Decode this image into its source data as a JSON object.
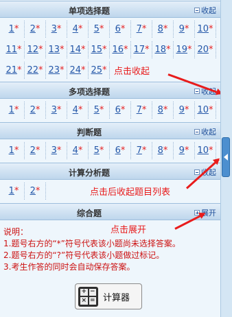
{
  "sections": [
    {
      "title": "单项选择题",
      "toggle": "收起",
      "rows": [
        [
          "1",
          "2",
          "3",
          "4",
          "5",
          "6",
          "7",
          "8",
          "9",
          "10"
        ],
        [
          "11",
          "12",
          "13",
          "14",
          "15",
          "16",
          "17",
          "18",
          "19",
          "20"
        ],
        [
          "21",
          "22",
          "23",
          "24",
          "25"
        ]
      ]
    },
    {
      "title": "多项选择题",
      "toggle": "收起",
      "rows": [
        [
          "1",
          "2",
          "3",
          "4",
          "5",
          "6",
          "7",
          "8",
          "9",
          "10"
        ]
      ]
    },
    {
      "title": "判断题",
      "toggle": "收起",
      "rows": [
        [
          "1",
          "2",
          "3",
          "4",
          "5",
          "6",
          "7",
          "8",
          "9",
          "10"
        ]
      ]
    },
    {
      "title": "计算分析题",
      "toggle": "收起",
      "rows": [
        [
          "1",
          "2"
        ]
      ]
    },
    {
      "title": "综合题",
      "toggle": "展开",
      "rows": []
    }
  ],
  "unanswered_mark": "*",
  "annotations": {
    "collapse": "点击收起",
    "collapsed_list": "点击后收起题目列表",
    "expand": "点击展开"
  },
  "notes": {
    "heading": "说明：",
    "line1": "1.题号右方的“*”符号代表该小题尚未选择答案。",
    "line2": "2.题号右方的“?”符号代表该小题做过标记。",
    "line3": "3.考生作答的同时会自动保存答案。"
  },
  "calculator": {
    "label": "计算器",
    "icon_symbols": [
      "+",
      "−",
      "×",
      "="
    ]
  }
}
